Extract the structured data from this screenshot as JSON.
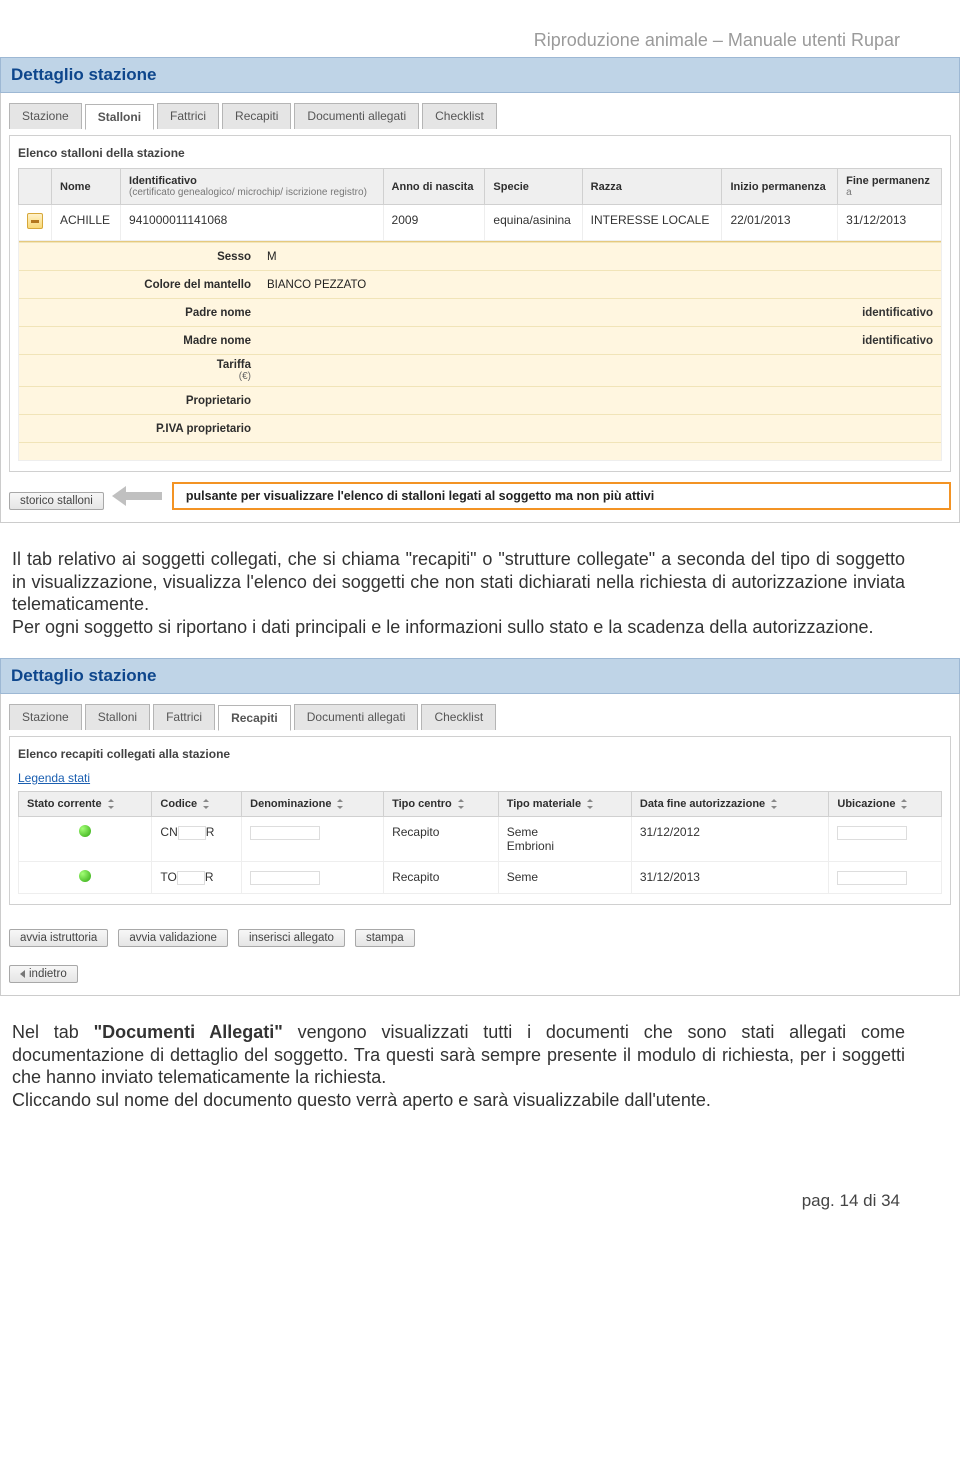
{
  "doc_header": "Riproduzione animale – Manuale utenti Rupar",
  "screenshot1": {
    "panel_title": "Dettaglio stazione",
    "tabs": [
      "Stazione",
      "Stalloni",
      "Fattrici",
      "Recapiti",
      "Documenti allegati",
      "Checklist"
    ],
    "active_tab_index": 1,
    "fieldset_title": "Elenco stalloni della stazione",
    "columns": {
      "c0": "",
      "c1": "Nome",
      "c2_main": "Identificativo",
      "c2_sub": "(certificato genealogico/ microchip/ iscrizione registro)",
      "c3": "Anno di nascita",
      "c4": "Specie",
      "c5": "Razza",
      "c6": "Inizio permanenza",
      "c7_main": "Fine permanenz",
      "c7_sub": "a"
    },
    "row": {
      "nome": "ACHILLE",
      "ident": "941000011141068",
      "anno": "2009",
      "specie": "equina/asinina",
      "razza": "INTERESSE LOCALE",
      "inizio": "22/01/2013",
      "fine": "31/12/2013"
    },
    "details": [
      {
        "label": "Sesso",
        "sub": "",
        "value": "M",
        "extra": ""
      },
      {
        "label": "Colore del mantello",
        "sub": "",
        "value": "BIANCO PEZZATO",
        "extra": ""
      },
      {
        "label": "Padre nome",
        "sub": "",
        "value": "",
        "extra": "identificativo"
      },
      {
        "label": "Madre nome",
        "sub": "",
        "value": "",
        "extra": "identificativo"
      },
      {
        "label": "Tariffa",
        "sub": "(€)",
        "value": "",
        "extra": ""
      },
      {
        "label": "Proprietario",
        "sub": "",
        "value": "",
        "extra": ""
      },
      {
        "label": "P.IVA proprietario",
        "sub": "",
        "value": "",
        "extra": ""
      }
    ],
    "button_storico": "storico stalloni",
    "callout": "pulsante per visualizzare l'elenco di stalloni legati al soggetto ma non più attivi"
  },
  "paragraph1": "Il tab relativo ai soggetti collegati, che si chiama \"recapiti\" o \"strutture collegate\" a seconda del tipo di soggetto in visualizzazione, visualizza l'elenco dei soggetti che non stati dichiarati nella richiesta di autorizzazione inviata telematicamente.\nPer ogni soggetto si riportano i dati principali e le informazioni sullo stato e la scadenza della autorizzazione.",
  "screenshot2": {
    "panel_title": "Dettaglio stazione",
    "tabs": [
      "Stazione",
      "Stalloni",
      "Fattrici",
      "Recapiti",
      "Documenti allegati",
      "Checklist"
    ],
    "active_tab_index": 3,
    "fieldset_title": "Elenco recapiti collegati alla stazione",
    "legend_link": "Legenda stati",
    "columns": [
      "Stato corrente",
      "Codice",
      "Denominazione",
      "Tipo centro",
      "Tipo materiale",
      "Data fine autorizzazione",
      "Ubicazione"
    ],
    "rows": [
      {
        "stato": "green",
        "codice_pre": "CN",
        "codice_post": "R",
        "denom": "",
        "tipo_centro": "Recapito",
        "tipo_materiale": "Seme\nEmbrioni",
        "data_fine": "31/12/2012",
        "ubic": ""
      },
      {
        "stato": "green",
        "codice_pre": "TO",
        "codice_post": "R",
        "denom": "",
        "tipo_centro": "Recapito",
        "tipo_materiale": "Seme",
        "data_fine": "31/12/2013",
        "ubic": ""
      }
    ],
    "buttons": [
      "avvia istruttoria",
      "avvia validazione",
      "inserisci allegato",
      "stampa"
    ],
    "back": "indietro"
  },
  "paragraph2_pre": "Nel tab ",
  "paragraph2_bold": "\"Documenti Allegati\"",
  "paragraph2_post": " vengono visualizzati tutti i documenti che sono stati allegati come documentazione di dettaglio del soggetto. Tra questi sarà sempre presente il modulo di richiesta, per i soggetti che hanno inviato telematicamente la richiesta.\nCliccando sul nome del documento questo verrà aperto e sarà visualizzabile dall'utente.",
  "footer": "pag. 14 di 34"
}
